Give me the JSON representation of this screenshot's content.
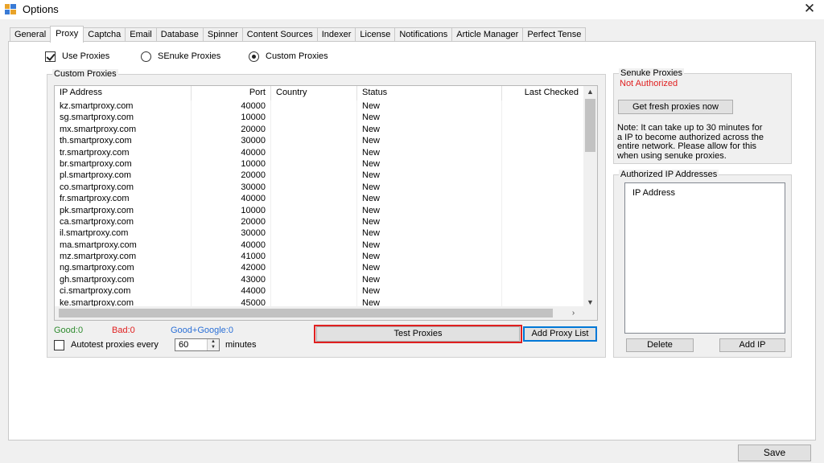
{
  "window": {
    "title": "Options",
    "close_glyph": "✕"
  },
  "tabs": [
    "General",
    "Proxy",
    "Captcha",
    "Email",
    "Database",
    "Spinner",
    "Content Sources",
    "Indexer",
    "License",
    "Notifications",
    "Article Manager",
    "Perfect Tense"
  ],
  "active_tab": "Proxy",
  "options": {
    "use_proxies": {
      "label": "Use Proxies",
      "checked": true
    },
    "senuke_proxies": {
      "label": "SEnuke Proxies",
      "selected": false
    },
    "custom_proxies": {
      "label": "Custom Proxies",
      "selected": true
    }
  },
  "custom_group": {
    "title": "Custom Proxies",
    "columns": [
      "IP Address",
      "Port",
      "Country",
      "Status",
      "Last Checked"
    ],
    "rows": [
      [
        "kz.smartproxy.com",
        "40000",
        "",
        "New",
        ""
      ],
      [
        "sg.smartproxy.com",
        "10000",
        "",
        "New",
        ""
      ],
      [
        "mx.smartproxy.com",
        "20000",
        "",
        "New",
        ""
      ],
      [
        "th.smartproxy.com",
        "30000",
        "",
        "New",
        ""
      ],
      [
        "tr.smartproxy.com",
        "40000",
        "",
        "New",
        ""
      ],
      [
        "br.smartproxy.com",
        "10000",
        "",
        "New",
        ""
      ],
      [
        "pl.smartproxy.com",
        "20000",
        "",
        "New",
        ""
      ],
      [
        "co.smartproxy.com",
        "30000",
        "",
        "New",
        ""
      ],
      [
        "fr.smartproxy.com",
        "40000",
        "",
        "New",
        ""
      ],
      [
        "pk.smartproxy.com",
        "10000",
        "",
        "New",
        ""
      ],
      [
        "ca.smartproxy.com",
        "20000",
        "",
        "New",
        ""
      ],
      [
        "il.smartproxy.com",
        "30000",
        "",
        "New",
        ""
      ],
      [
        "ma.smartproxy.com",
        "40000",
        "",
        "New",
        ""
      ],
      [
        "mz.smartproxy.com",
        "41000",
        "",
        "New",
        ""
      ],
      [
        "ng.smartproxy.com",
        "42000",
        "",
        "New",
        ""
      ],
      [
        "gh.smartproxy.com",
        "43000",
        "",
        "New",
        ""
      ],
      [
        "ci.smartproxy.com",
        "44000",
        "",
        "New",
        ""
      ],
      [
        "ke.smartproxy.com",
        "45000",
        "",
        "New",
        ""
      ]
    ],
    "good_label": "Good:0",
    "bad_label": "Bad:0",
    "good_google_label": "Good+Google:0",
    "autotest_label": "Autotest proxies every",
    "autotest_value": "60",
    "minutes_label": "minutes",
    "test_button": "Test Proxies",
    "add_list_button": "Add Proxy List"
  },
  "senuke_group": {
    "title": "Senuke Proxies",
    "status": "Not Authorized",
    "fresh_button": "Get fresh proxies now",
    "note_lines": [
      "Note: It can take up to 30 minutes for",
      "a IP to become authorized across the",
      "entire network. Please allow for this",
      "when using senuke proxies."
    ]
  },
  "authorized_group": {
    "title": "Authorized IP Addresses",
    "list_header": "IP Address",
    "delete_button": "Delete",
    "add_ip_button": "Add IP"
  },
  "footer": {
    "save_button": "Save"
  },
  "colors": {
    "good": "#2e8b2e",
    "bad": "#e02020",
    "good_google": "#2a6fd6",
    "highlight": "#e02020",
    "accent": "#0078d7"
  }
}
